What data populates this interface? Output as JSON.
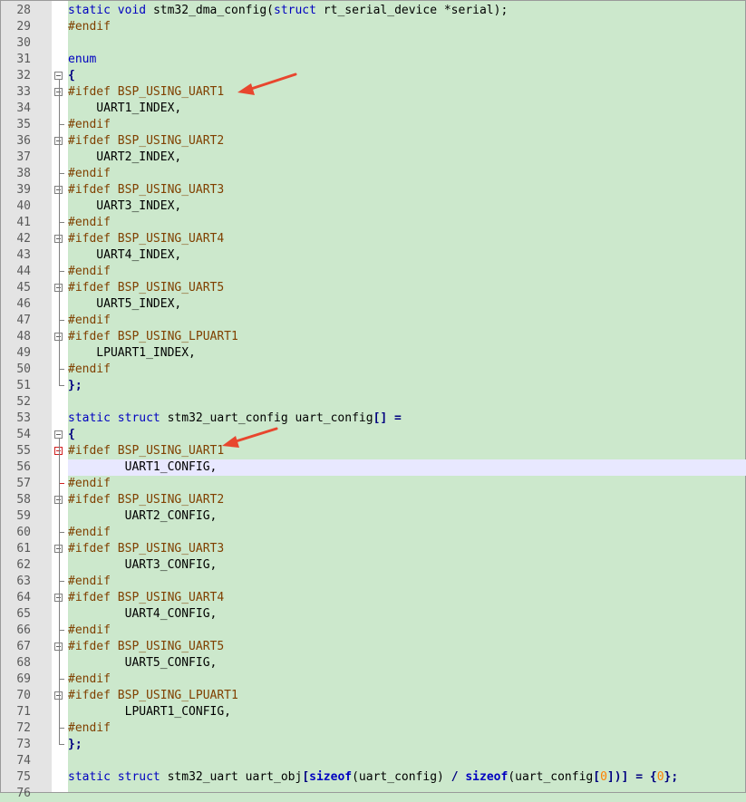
{
  "colors": {
    "background": "#cce8cc",
    "keyword": "#0000c0",
    "preprocessor": "#804000",
    "number": "#ff8000",
    "annotation_arrow": "#e8462e"
  },
  "current_line": 56,
  "lines": [
    {
      "n": "28",
      "tokens": [
        {
          "t": "static ",
          "c": "kw"
        },
        {
          "t": "void ",
          "c": "kw"
        },
        {
          "t": "stm32_dma_config("
        },
        {
          "t": "struct ",
          "c": "kw"
        },
        {
          "t": "rt_serial_device *serial);"
        }
      ]
    },
    {
      "n": "29",
      "tokens": [
        {
          "t": "#endif",
          "c": "pp"
        }
      ]
    },
    {
      "n": "30",
      "tokens": []
    },
    {
      "n": "31",
      "tokens": [
        {
          "t": "enum",
          "c": "kw"
        }
      ]
    },
    {
      "n": "32",
      "tokens": [
        {
          "t": "{",
          "c": "op"
        }
      ]
    },
    {
      "n": "33",
      "tokens": [
        {
          "t": "#ifdef BSP_USING_UART1",
          "c": "pp"
        }
      ]
    },
    {
      "n": "34",
      "tokens": [
        {
          "t": "    UART1_INDEX,"
        }
      ]
    },
    {
      "n": "35",
      "tokens": [
        {
          "t": "#endif",
          "c": "pp"
        }
      ]
    },
    {
      "n": "36",
      "tokens": [
        {
          "t": "#ifdef BSP_USING_UART2",
          "c": "pp"
        }
      ]
    },
    {
      "n": "37",
      "tokens": [
        {
          "t": "    UART2_INDEX,"
        }
      ]
    },
    {
      "n": "38",
      "tokens": [
        {
          "t": "#endif",
          "c": "pp"
        }
      ]
    },
    {
      "n": "39",
      "tokens": [
        {
          "t": "#ifdef BSP_USING_UART3",
          "c": "pp"
        }
      ]
    },
    {
      "n": "40",
      "tokens": [
        {
          "t": "    UART3_INDEX,"
        }
      ]
    },
    {
      "n": "41",
      "tokens": [
        {
          "t": "#endif",
          "c": "pp"
        }
      ]
    },
    {
      "n": "42",
      "tokens": [
        {
          "t": "#ifdef BSP_USING_UART4",
          "c": "pp"
        }
      ]
    },
    {
      "n": "43",
      "tokens": [
        {
          "t": "    UART4_INDEX,"
        }
      ]
    },
    {
      "n": "44",
      "tokens": [
        {
          "t": "#endif",
          "c": "pp"
        }
      ]
    },
    {
      "n": "45",
      "tokens": [
        {
          "t": "#ifdef BSP_USING_UART5",
          "c": "pp"
        }
      ]
    },
    {
      "n": "46",
      "tokens": [
        {
          "t": "    UART5_INDEX,"
        }
      ]
    },
    {
      "n": "47",
      "tokens": [
        {
          "t": "#endif",
          "c": "pp"
        }
      ]
    },
    {
      "n": "48",
      "tokens": [
        {
          "t": "#ifdef BSP_USING_LPUART1",
          "c": "pp"
        }
      ]
    },
    {
      "n": "49",
      "tokens": [
        {
          "t": "    LPUART1_INDEX,"
        }
      ]
    },
    {
      "n": "50",
      "tokens": [
        {
          "t": "#endif",
          "c": "pp"
        }
      ]
    },
    {
      "n": "51",
      "tokens": [
        {
          "t": "};",
          "c": "op"
        }
      ]
    },
    {
      "n": "52",
      "tokens": []
    },
    {
      "n": "53",
      "tokens": [
        {
          "t": "static ",
          "c": "kw"
        },
        {
          "t": "struct ",
          "c": "kw"
        },
        {
          "t": "stm32_uart_config uart_config"
        },
        {
          "t": "[] =",
          "c": "op"
        }
      ]
    },
    {
      "n": "54",
      "tokens": [
        {
          "t": "{",
          "c": "op"
        }
      ]
    },
    {
      "n": "55",
      "tokens": [
        {
          "t": "#ifdef BSP_USING_UART1",
          "c": "pp"
        }
      ]
    },
    {
      "n": "56",
      "tokens": [
        {
          "t": "        UART1_CONFIG,"
        }
      ]
    },
    {
      "n": "57",
      "tokens": [
        {
          "t": "#endif",
          "c": "pp"
        }
      ]
    },
    {
      "n": "58",
      "tokens": [
        {
          "t": "#ifdef BSP_USING_UART2",
          "c": "pp"
        }
      ]
    },
    {
      "n": "59",
      "tokens": [
        {
          "t": "        UART2_CONFIG,"
        }
      ]
    },
    {
      "n": "60",
      "tokens": [
        {
          "t": "#endif",
          "c": "pp"
        }
      ]
    },
    {
      "n": "61",
      "tokens": [
        {
          "t": "#ifdef BSP_USING_UART3",
          "c": "pp"
        }
      ]
    },
    {
      "n": "62",
      "tokens": [
        {
          "t": "        UART3_CONFIG,"
        }
      ]
    },
    {
      "n": "63",
      "tokens": [
        {
          "t": "#endif",
          "c": "pp"
        }
      ]
    },
    {
      "n": "64",
      "tokens": [
        {
          "t": "#ifdef BSP_USING_UART4",
          "c": "pp"
        }
      ]
    },
    {
      "n": "65",
      "tokens": [
        {
          "t": "        UART4_CONFIG,"
        }
      ]
    },
    {
      "n": "66",
      "tokens": [
        {
          "t": "#endif",
          "c": "pp"
        }
      ]
    },
    {
      "n": "67",
      "tokens": [
        {
          "t": "#ifdef BSP_USING_UART5",
          "c": "pp"
        }
      ]
    },
    {
      "n": "68",
      "tokens": [
        {
          "t": "        UART5_CONFIG,"
        }
      ]
    },
    {
      "n": "69",
      "tokens": [
        {
          "t": "#endif",
          "c": "pp"
        }
      ]
    },
    {
      "n": "70",
      "tokens": [
        {
          "t": "#ifdef BSP_USING_LPUART1",
          "c": "pp"
        }
      ]
    },
    {
      "n": "71",
      "tokens": [
        {
          "t": "        LPUART1_CONFIG,"
        }
      ]
    },
    {
      "n": "72",
      "tokens": [
        {
          "t": "#endif",
          "c": "pp"
        }
      ]
    },
    {
      "n": "73",
      "tokens": [
        {
          "t": "};",
          "c": "op"
        }
      ]
    },
    {
      "n": "74",
      "tokens": []
    },
    {
      "n": "75",
      "tokens": [
        {
          "t": "static ",
          "c": "kw"
        },
        {
          "t": "struct ",
          "c": "kw"
        },
        {
          "t": "stm32_uart uart_obj"
        },
        {
          "t": "[",
          "c": "op"
        },
        {
          "t": "sizeof",
          "c": "bkw"
        },
        {
          "t": "(uart_config) "
        },
        {
          "t": "/ ",
          "c": "op"
        },
        {
          "t": "sizeof",
          "c": "bkw"
        },
        {
          "t": "(uart_config"
        },
        {
          "t": "[",
          "c": "op"
        },
        {
          "t": "0",
          "c": "num"
        },
        {
          "t": "])] = {",
          "c": "op"
        },
        {
          "t": "0",
          "c": "num"
        },
        {
          "t": "};",
          "c": "op"
        }
      ]
    },
    {
      "n": "76",
      "tokens": []
    }
  ],
  "fold_markers": [
    32,
    33,
    36,
    39,
    42,
    45,
    48,
    54,
    55,
    58,
    61,
    64,
    67,
    70
  ],
  "active_fold": 55,
  "fold_ends": [
    35,
    38,
    41,
    44,
    47,
    50,
    51,
    57,
    60,
    63,
    66,
    69,
    72,
    73
  ]
}
